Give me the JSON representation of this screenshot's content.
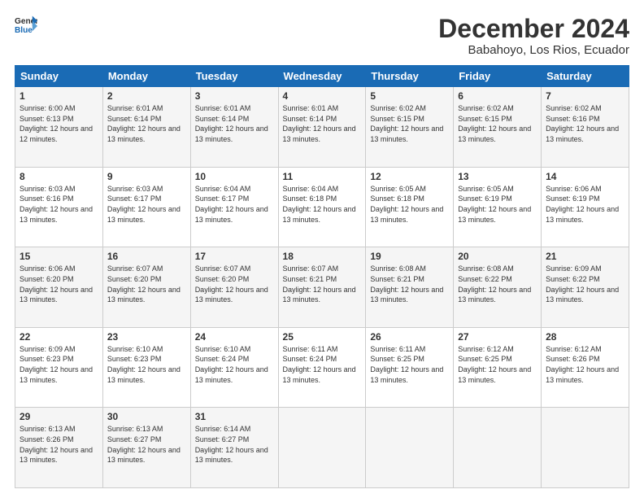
{
  "logo": {
    "line1": "General",
    "line2": "Blue"
  },
  "title": "December 2024",
  "subtitle": "Babahoyo, Los Rios, Ecuador",
  "days_of_week": [
    "Sunday",
    "Monday",
    "Tuesday",
    "Wednesday",
    "Thursday",
    "Friday",
    "Saturday"
  ],
  "weeks": [
    [
      {
        "day": "1",
        "sunrise": "6:00 AM",
        "sunset": "6:13 PM",
        "daylight": "12 hours and 12 minutes."
      },
      {
        "day": "2",
        "sunrise": "6:01 AM",
        "sunset": "6:14 PM",
        "daylight": "12 hours and 13 minutes."
      },
      {
        "day": "3",
        "sunrise": "6:01 AM",
        "sunset": "6:14 PM",
        "daylight": "12 hours and 13 minutes."
      },
      {
        "day": "4",
        "sunrise": "6:01 AM",
        "sunset": "6:14 PM",
        "daylight": "12 hours and 13 minutes."
      },
      {
        "day": "5",
        "sunrise": "6:02 AM",
        "sunset": "6:15 PM",
        "daylight": "12 hours and 13 minutes."
      },
      {
        "day": "6",
        "sunrise": "6:02 AM",
        "sunset": "6:15 PM",
        "daylight": "12 hours and 13 minutes."
      },
      {
        "day": "7",
        "sunrise": "6:02 AM",
        "sunset": "6:16 PM",
        "daylight": "12 hours and 13 minutes."
      }
    ],
    [
      {
        "day": "8",
        "sunrise": "6:03 AM",
        "sunset": "6:16 PM",
        "daylight": "12 hours and 13 minutes."
      },
      {
        "day": "9",
        "sunrise": "6:03 AM",
        "sunset": "6:17 PM",
        "daylight": "12 hours and 13 minutes."
      },
      {
        "day": "10",
        "sunrise": "6:04 AM",
        "sunset": "6:17 PM",
        "daylight": "12 hours and 13 minutes."
      },
      {
        "day": "11",
        "sunrise": "6:04 AM",
        "sunset": "6:18 PM",
        "daylight": "12 hours and 13 minutes."
      },
      {
        "day": "12",
        "sunrise": "6:05 AM",
        "sunset": "6:18 PM",
        "daylight": "12 hours and 13 minutes."
      },
      {
        "day": "13",
        "sunrise": "6:05 AM",
        "sunset": "6:19 PM",
        "daylight": "12 hours and 13 minutes."
      },
      {
        "day": "14",
        "sunrise": "6:06 AM",
        "sunset": "6:19 PM",
        "daylight": "12 hours and 13 minutes."
      }
    ],
    [
      {
        "day": "15",
        "sunrise": "6:06 AM",
        "sunset": "6:20 PM",
        "daylight": "12 hours and 13 minutes."
      },
      {
        "day": "16",
        "sunrise": "6:07 AM",
        "sunset": "6:20 PM",
        "daylight": "12 hours and 13 minutes."
      },
      {
        "day": "17",
        "sunrise": "6:07 AM",
        "sunset": "6:20 PM",
        "daylight": "12 hours and 13 minutes."
      },
      {
        "day": "18",
        "sunrise": "6:07 AM",
        "sunset": "6:21 PM",
        "daylight": "12 hours and 13 minutes."
      },
      {
        "day": "19",
        "sunrise": "6:08 AM",
        "sunset": "6:21 PM",
        "daylight": "12 hours and 13 minutes."
      },
      {
        "day": "20",
        "sunrise": "6:08 AM",
        "sunset": "6:22 PM",
        "daylight": "12 hours and 13 minutes."
      },
      {
        "day": "21",
        "sunrise": "6:09 AM",
        "sunset": "6:22 PM",
        "daylight": "12 hours and 13 minutes."
      }
    ],
    [
      {
        "day": "22",
        "sunrise": "6:09 AM",
        "sunset": "6:23 PM",
        "daylight": "12 hours and 13 minutes."
      },
      {
        "day": "23",
        "sunrise": "6:10 AM",
        "sunset": "6:23 PM",
        "daylight": "12 hours and 13 minutes."
      },
      {
        "day": "24",
        "sunrise": "6:10 AM",
        "sunset": "6:24 PM",
        "daylight": "12 hours and 13 minutes."
      },
      {
        "day": "25",
        "sunrise": "6:11 AM",
        "sunset": "6:24 PM",
        "daylight": "12 hours and 13 minutes."
      },
      {
        "day": "26",
        "sunrise": "6:11 AM",
        "sunset": "6:25 PM",
        "daylight": "12 hours and 13 minutes."
      },
      {
        "day": "27",
        "sunrise": "6:12 AM",
        "sunset": "6:25 PM",
        "daylight": "12 hours and 13 minutes."
      },
      {
        "day": "28",
        "sunrise": "6:12 AM",
        "sunset": "6:26 PM",
        "daylight": "12 hours and 13 minutes."
      }
    ],
    [
      {
        "day": "29",
        "sunrise": "6:13 AM",
        "sunset": "6:26 PM",
        "daylight": "12 hours and 13 minutes."
      },
      {
        "day": "30",
        "sunrise": "6:13 AM",
        "sunset": "6:27 PM",
        "daylight": "12 hours and 13 minutes."
      },
      {
        "day": "31",
        "sunrise": "6:14 AM",
        "sunset": "6:27 PM",
        "daylight": "12 hours and 13 minutes."
      },
      null,
      null,
      null,
      null
    ]
  ],
  "labels": {
    "sunrise": "Sunrise:",
    "sunset": "Sunset:",
    "daylight": "Daylight:"
  }
}
